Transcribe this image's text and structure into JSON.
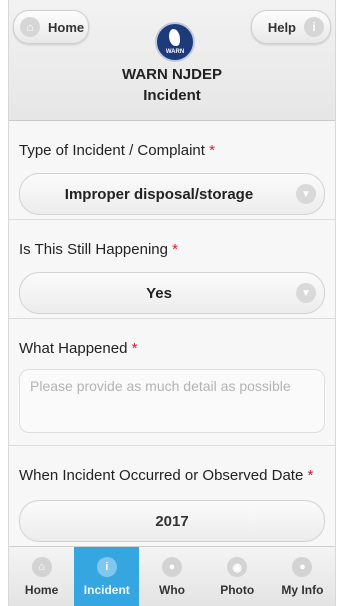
{
  "header": {
    "home_label": "Home",
    "help_label": "Help",
    "title_line1": "WARN NJDEP",
    "title_line2": "Incident",
    "logo_text": "WARN"
  },
  "form": {
    "type_of_incident": {
      "label": "Type of Incident / Complaint",
      "required_mark": "*",
      "value": "Improper disposal/storage"
    },
    "still_happening": {
      "label": "Is This Still Happening",
      "required_mark": "*",
      "value": "Yes"
    },
    "what_happened": {
      "label": "What Happened",
      "required_mark": "*",
      "placeholder": "Please provide as much detail as possible"
    },
    "when_occurred": {
      "label": "When Incident Occurred or Observed Date",
      "required_mark": "*",
      "value_partial": "2017"
    }
  },
  "tabs": [
    {
      "label": "Home",
      "icon": "home-icon",
      "active": false
    },
    {
      "label": "Incident",
      "icon": "info-icon",
      "active": true
    },
    {
      "label": "Who",
      "icon": "person-icon",
      "active": false
    },
    {
      "label": "Photo",
      "icon": "camera-icon",
      "active": false
    },
    {
      "label": "My Info",
      "icon": "user-icon",
      "active": false
    }
  ],
  "colors": {
    "accent": "#35a6e0",
    "required": "#e0182a",
    "logo": "#1d3b7a"
  }
}
